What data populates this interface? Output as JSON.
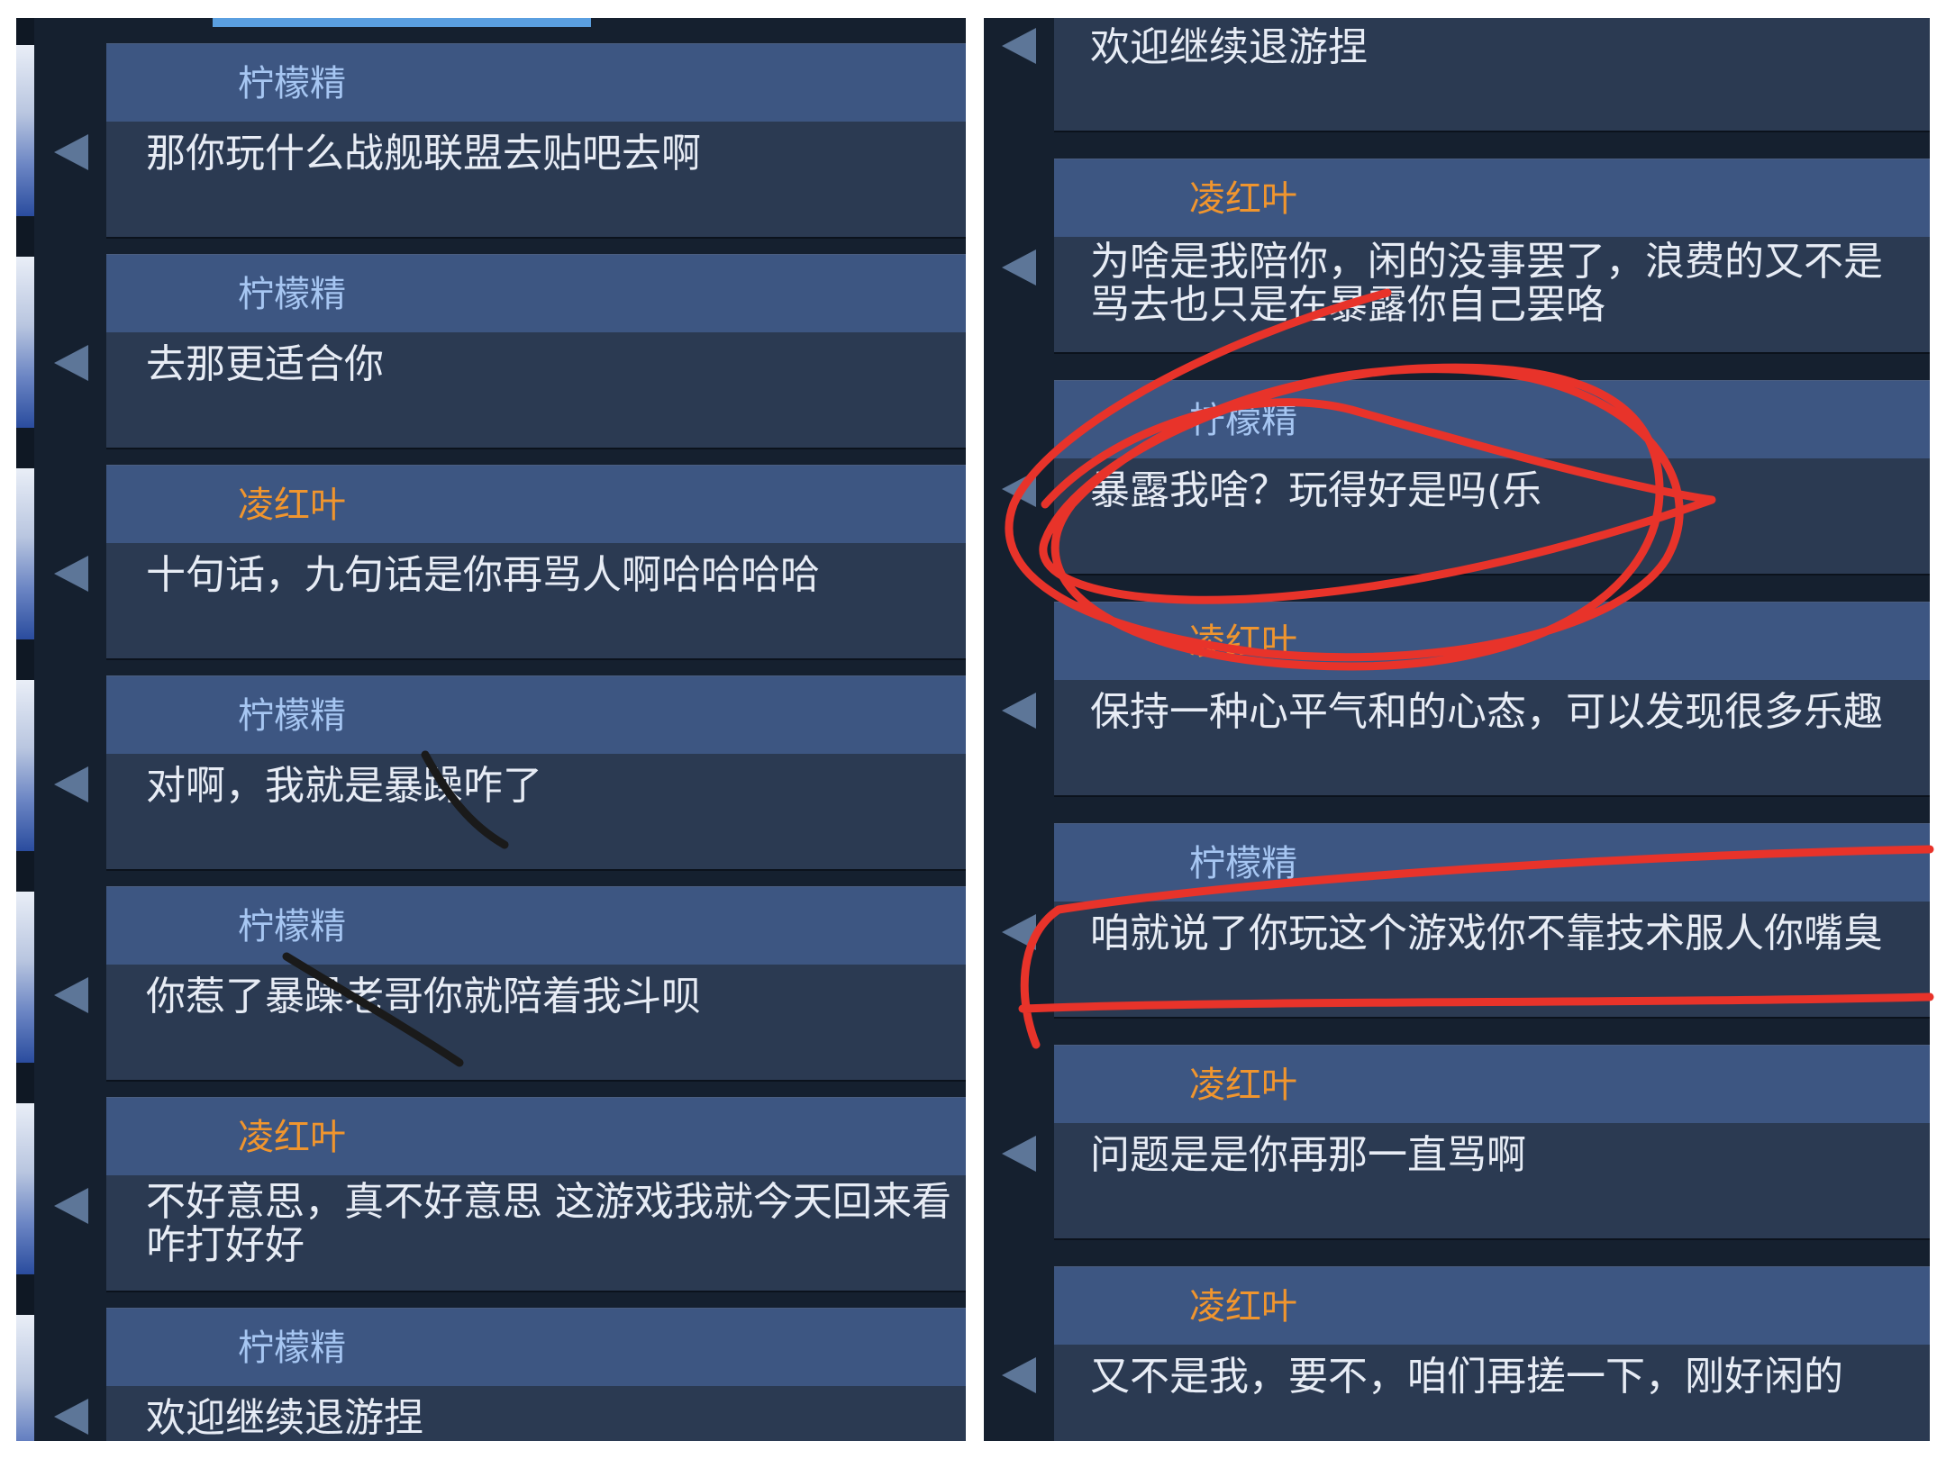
{
  "left_panel": {
    "messages": [
      {
        "sender": "柠檬精",
        "text": "那你玩什么战舰联盟去贴吧去啊",
        "sender_color": "#a6c6f2"
      },
      {
        "sender": "柠檬精",
        "text": "去那更适合你",
        "sender_color": "#a6c6f2"
      },
      {
        "sender": "凌红叶",
        "text": "十句话，九句话是你再骂人啊哈哈哈哈",
        "sender_color": "#f0952e"
      },
      {
        "sender": "柠檬精",
        "text": "对啊，我就是暴躁咋了",
        "sender_color": "#a6c6f2"
      },
      {
        "sender": "柠檬精",
        "text": "你惹了暴躁老哥你就陪着我斗呗",
        "sender_color": "#a6c6f2"
      },
      {
        "sender": "凌红叶",
        "text": "不好意思，真不好意思 这游戏我就今天回来看\n咋打好好",
        "sender_color": "#f0952e"
      },
      {
        "sender": "柠檬精",
        "text": "欢迎继续退游捏",
        "sender_color": "#a6c6f2"
      }
    ]
  },
  "right_panel": {
    "top_text": "欢迎继续退游捏",
    "messages": [
      {
        "sender": "凌红叶",
        "text": "为啥是我陪你，闲的没事罢了，浪费的又不是\n骂去也只是在暴露你自己罢咯",
        "sender_color": "#f0952e"
      },
      {
        "sender": "柠檬精",
        "text": "暴露我啥？玩得好是吗(乐",
        "sender_color": "#a6c6f2"
      },
      {
        "sender": "凌红叶",
        "text": "保持一种心平气和的心态，可以发现很多乐趣",
        "sender_color": "#f0952e"
      },
      {
        "sender": "柠檬精",
        "text": "咱就说了你玩这个游戏你不靠技术服人你嘴臭",
        "sender_color": "#a6c6f2"
      },
      {
        "sender": "凌红叶",
        "text": "问题是是你再那一直骂啊",
        "sender_color": "#f0952e"
      },
      {
        "sender": "凌红叶",
        "text": "又不是我，要不，咱们再搓一下，刚好闲的",
        "sender_color": "#f0952e"
      }
    ]
  },
  "annotations": {
    "red_marker_color": "#e8332a",
    "black_marker_color": "#1a1a1a"
  }
}
